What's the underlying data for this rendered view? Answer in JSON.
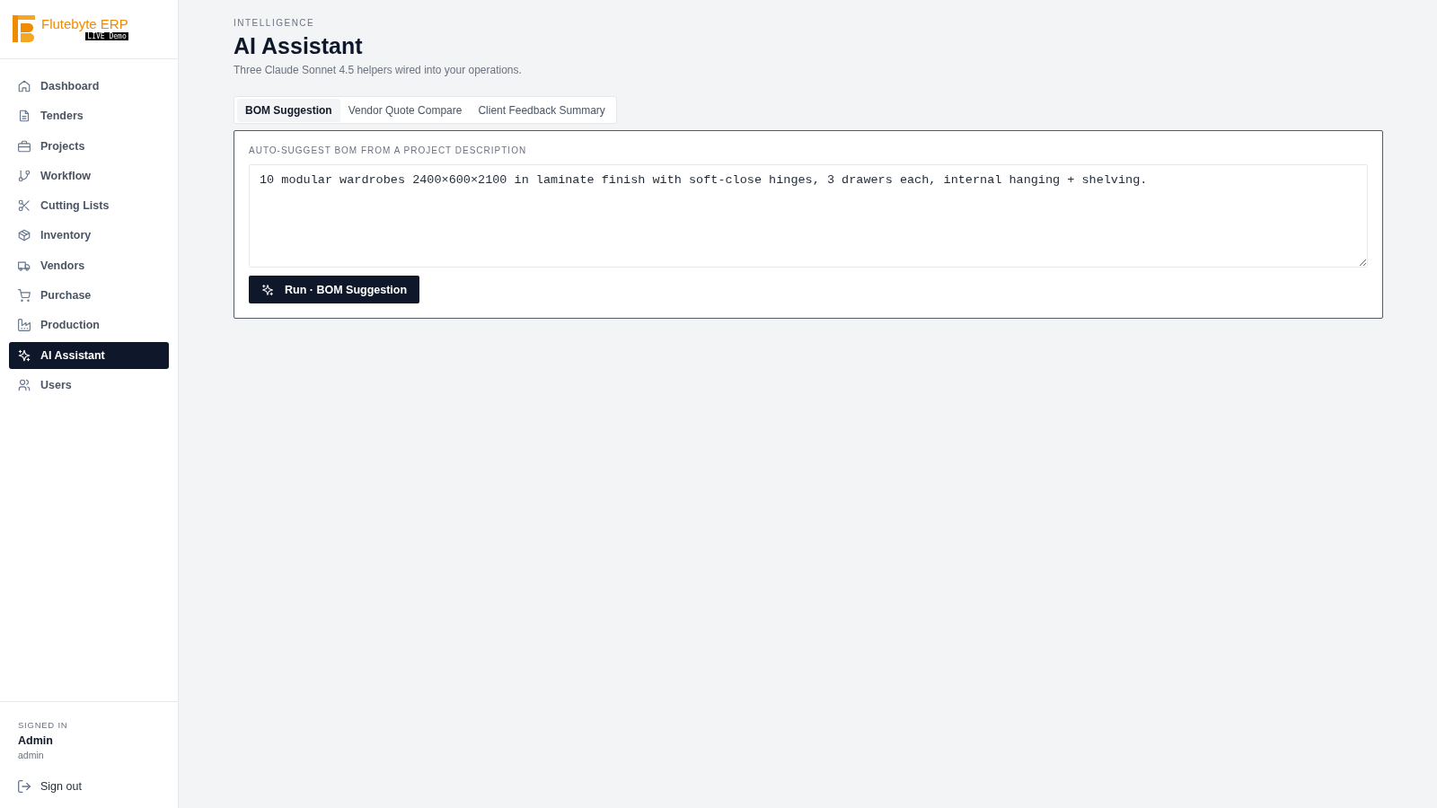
{
  "sidebar": {
    "logo": {
      "name": "Flutebyte ERP",
      "badge": "LIVE Demo"
    },
    "items": [
      {
        "label": "Dashboard",
        "selected": false
      },
      {
        "label": "Tenders",
        "selected": false
      },
      {
        "label": "Projects",
        "selected": false
      },
      {
        "label": "Workflow",
        "selected": false
      },
      {
        "label": "Cutting Lists",
        "selected": false
      },
      {
        "label": "Inventory",
        "selected": false
      },
      {
        "label": "Vendors",
        "selected": false
      },
      {
        "label": "Purchase",
        "selected": false
      },
      {
        "label": "Production",
        "selected": false
      },
      {
        "label": "AI Assistant",
        "selected": true
      },
      {
        "label": "Users",
        "selected": false
      }
    ],
    "user": {
      "caption": "SIGNED IN",
      "name": "Admin",
      "username": "admin"
    },
    "sign_out": "Sign out"
  },
  "header": {
    "eyebrow": "INTELLIGENCE",
    "title": "AI Assistant",
    "subtitle": "Three Claude Sonnet 4.5 helpers wired into your operations."
  },
  "tabs": [
    {
      "label": "BOM Suggestion",
      "selected": true
    },
    {
      "label": "Vendor Quote Compare",
      "selected": false
    },
    {
      "label": "Client Feedback Summary",
      "selected": false
    }
  ],
  "panel": {
    "label": "AUTO-SUGGEST BOM FROM A PROJECT DESCRIPTION",
    "value": "10 modular wardrobes 2400×600×2100 in laminate finish with soft-close hinges, 3 drawers each, internal hanging + shelving.",
    "button": "Run · BOM Suggestion"
  }
}
